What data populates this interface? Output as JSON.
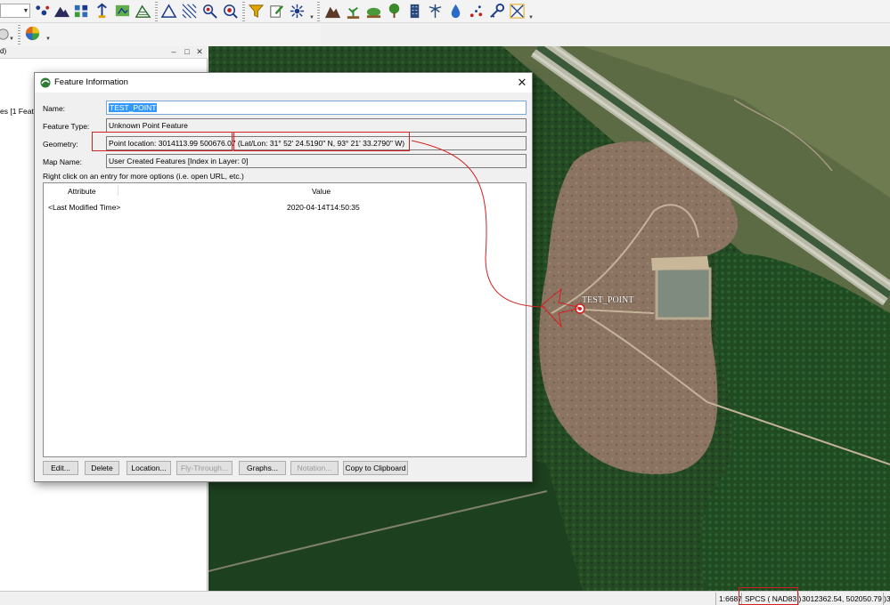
{
  "toolbar": {
    "icons": [
      "layer-points-icon",
      "terrain-icon",
      "overlay-control-icon",
      "pin-icon",
      "map-green-icon",
      "mountain-grid-icon",
      "measure-triangle-icon",
      "hatch-area-icon",
      "search-pin-icon",
      "search-info-icon",
      "filter-funnel-icon",
      "edit-pencil-icon",
      "tools-icon",
      "mountain-dark-icon",
      "plant-icon",
      "shrub-icon",
      "tree-icon",
      "building-icon",
      "palm-icon",
      "water-drop-icon",
      "pattern-icon",
      "key-icon",
      "grid-arrows-icon"
    ],
    "row2_icons": [
      "settings-icon",
      "color-wheel-icon"
    ]
  },
  "left_panel": {
    "title_fragment": "d)",
    "item_fragment": "es [1 Featu"
  },
  "map": {
    "point_label": "TEST_POINT"
  },
  "status_bar": {
    "scale": "1:6687",
    "projection": "SPCS ( NAD83 )",
    "coordinates": "3012362.54, 502050.79 )",
    "trailing": "3"
  },
  "dialog": {
    "title": "Feature Information",
    "close_glyph": "✕",
    "name_label": "Name:",
    "name_value": "TEST_POINT",
    "type_label": "Feature Type:",
    "type_value": "Unknown Point Feature",
    "geometry_label": "Geometry:",
    "geometry_value": "Point location: 3014113.99 500676.07 (Lat/Lon: 31° 52' 24.5190\" N, 93° 21' 33.2790\" W)",
    "map_label": "Map Name:",
    "map_value": "User Created Features [Index in Layer: 0]",
    "hint": "Right click on an entry for more options (i.e. open URL, etc.)",
    "columns": [
      "Attribute",
      "Value"
    ],
    "rows": [
      {
        "attribute": "<Last Modified Time>",
        "value": "2020-04-14T14:50:35"
      }
    ],
    "buttons": {
      "edit": "Edit...",
      "delete": "Delete",
      "location": "Location...",
      "fly_through": "Fly-Through...",
      "graphs": "Graphs...",
      "notation": "Notation...",
      "copy": "Copy to Clipboard"
    }
  },
  "colors": {
    "annotation_red": "#d42020",
    "selection_blue": "#3399ff"
  }
}
